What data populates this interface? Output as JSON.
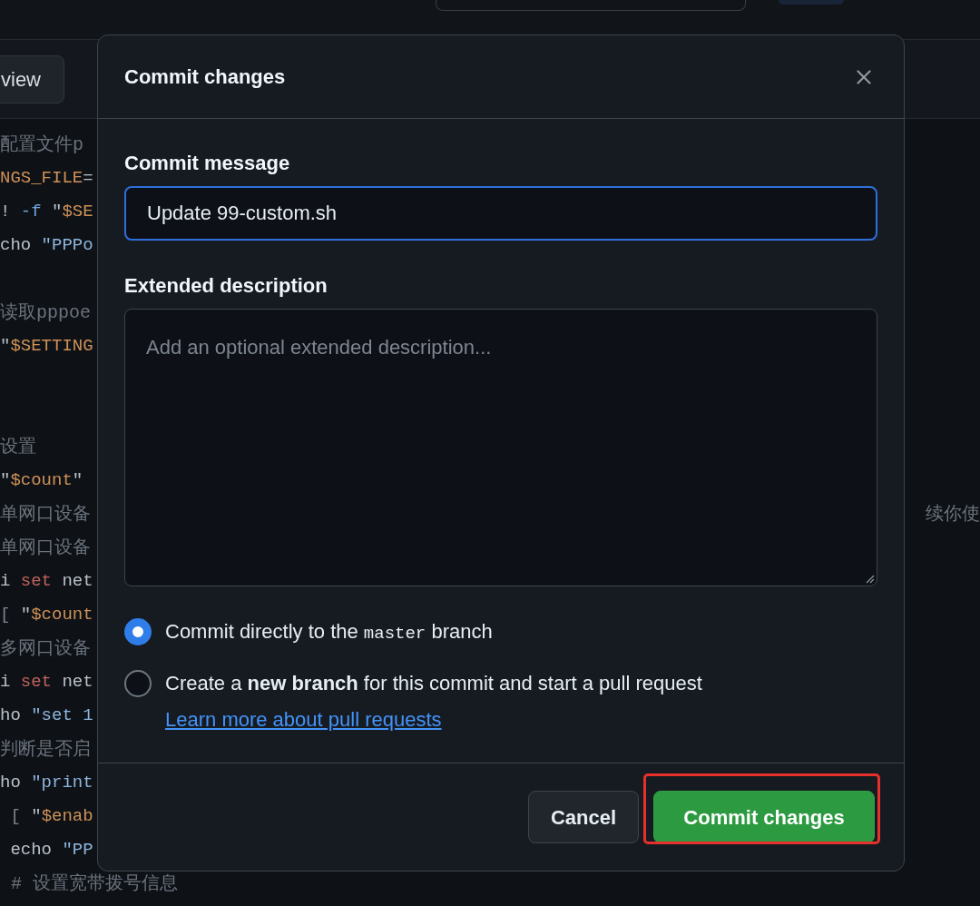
{
  "toolbar": {
    "tabs": [
      {
        "label": "view",
        "selected": true
      }
    ]
  },
  "code": {
    "lines": [
      {
        "kind": "code",
        "tokens": [
          {
            "kind": "comment",
            "text": "配置文件p"
          }
        ]
      },
      {
        "kind": "code",
        "tokens": [
          {
            "kind": "variable",
            "text": "NGS_FILE"
          },
          {
            "kind": "plain",
            "text": "="
          }
        ]
      },
      {
        "kind": "code",
        "tokens": [
          {
            "kind": "plain",
            "text": "! "
          },
          {
            "kind": "flag",
            "text": "-f"
          },
          {
            "kind": "plain",
            "text": " \""
          },
          {
            "kind": "variable",
            "text": "$SE"
          }
        ]
      },
      {
        "kind": "code",
        "tokens": [
          {
            "kind": "plain",
            "text": "cho "
          },
          {
            "kind": "string",
            "text": "\"PPPo"
          }
        ]
      },
      {
        "kind": "blank"
      },
      {
        "kind": "code",
        "tokens": [
          {
            "kind": "comment",
            "text": "读取pppoe"
          }
        ]
      },
      {
        "kind": "code",
        "tokens": [
          {
            "kind": "plain",
            "text": "\""
          },
          {
            "kind": "variable",
            "text": "$SETTING"
          }
        ]
      },
      {
        "kind": "blank"
      },
      {
        "kind": "blank"
      },
      {
        "kind": "code",
        "tokens": [
          {
            "kind": "comment",
            "text": "设置"
          }
        ]
      },
      {
        "kind": "code",
        "tokens": [
          {
            "kind": "plain",
            "text": "\""
          },
          {
            "kind": "variable",
            "text": "$count"
          },
          {
            "kind": "plain",
            "text": "\""
          }
        ]
      },
      {
        "kind": "code",
        "tokens": [
          {
            "kind": "comment",
            "text": "单网口设备"
          }
        ],
        "tail": "续你使"
      },
      {
        "kind": "code",
        "tokens": [
          {
            "kind": "comment",
            "text": "单网口设备"
          }
        ]
      },
      {
        "kind": "code",
        "tokens": [
          {
            "kind": "plain",
            "text": "i "
          },
          {
            "kind": "keyword",
            "text": "set"
          },
          {
            "kind": "plain",
            "text": " net"
          }
        ]
      },
      {
        "kind": "code",
        "tokens": [
          {
            "kind": "punct",
            "text": "[ "
          },
          {
            "kind": "plain",
            "text": "\""
          },
          {
            "kind": "variable",
            "text": "$count"
          }
        ]
      },
      {
        "kind": "code",
        "tokens": [
          {
            "kind": "comment",
            "text": "多网口设备"
          }
        ]
      },
      {
        "kind": "code",
        "tokens": [
          {
            "kind": "plain",
            "text": "i "
          },
          {
            "kind": "keyword",
            "text": "set"
          },
          {
            "kind": "plain",
            "text": " net"
          }
        ]
      },
      {
        "kind": "code",
        "tokens": [
          {
            "kind": "plain",
            "text": "ho "
          },
          {
            "kind": "string",
            "text": "\"set 1"
          }
        ]
      },
      {
        "kind": "code",
        "tokens": [
          {
            "kind": "comment",
            "text": "判断是否启"
          }
        ]
      },
      {
        "kind": "code",
        "tokens": [
          {
            "kind": "plain",
            "text": "ho "
          },
          {
            "kind": "string",
            "text": "\"print"
          }
        ]
      },
      {
        "kind": "code",
        "tokens": [
          {
            "kind": "punct",
            "text": " [ "
          },
          {
            "kind": "plain",
            "text": "\""
          },
          {
            "kind": "variable",
            "text": "$enab"
          }
        ]
      },
      {
        "kind": "code",
        "tokens": [
          {
            "kind": "plain",
            "text": " echo "
          },
          {
            "kind": "string",
            "text": "\"PP"
          }
        ]
      },
      {
        "kind": "code",
        "tokens": [
          {
            "kind": "comment",
            "text": " # 设置宽带拨号信息"
          }
        ]
      }
    ]
  },
  "dialog": {
    "title": "Commit changes",
    "fields": [
      {
        "kind": "input",
        "label": "Commit message",
        "value": "Update 99-custom.sh",
        "focused": true
      },
      {
        "kind": "textarea",
        "label": "Extended description",
        "placeholder": "Add an optional extended description...",
        "focused": false
      }
    ],
    "options": [
      {
        "selected": true,
        "parts": [
          {
            "kind": "text",
            "text": "Commit directly to the"
          },
          {
            "kind": "code",
            "text": "master"
          },
          {
            "kind": "text",
            "text": "branch"
          }
        ]
      },
      {
        "selected": false,
        "parts": [
          {
            "kind": "text",
            "text": "Create a **new branch** for this commit and start a pull request"
          },
          {
            "kind": "link",
            "text": "Learn more about pull requests"
          }
        ]
      }
    ],
    "buttons": [
      {
        "kind": "secondary",
        "label": "Cancel",
        "highlighted": false
      },
      {
        "kind": "primary",
        "label": "Commit changes",
        "highlighted": true
      }
    ]
  }
}
